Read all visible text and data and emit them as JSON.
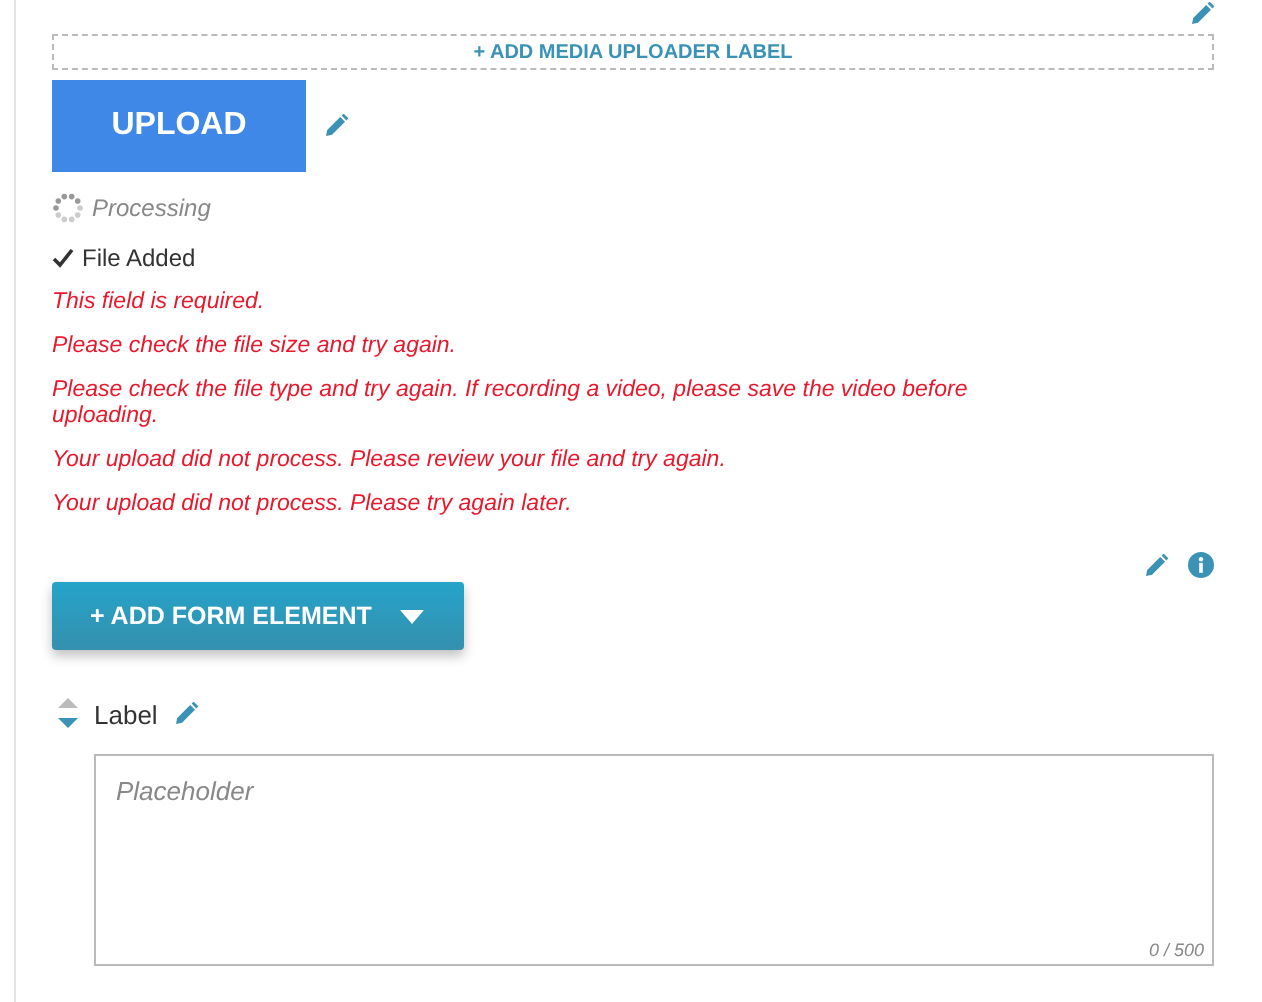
{
  "uploader": {
    "label_button": "+ ADD MEDIA UPLOADER LABEL",
    "upload_button": "UPLOAD",
    "statuses": [
      {
        "kind": "processing",
        "text": "Processing"
      },
      {
        "kind": "done",
        "text": "File Added"
      }
    ],
    "errors": [
      "This field is required.",
      "Please check the file size and try again.",
      "Please check the file type and try again. If recording a video, please save the video before uploading.",
      "Your upload did not process. Please review your file and try again.",
      "Your upload did not process. Please try again later."
    ]
  },
  "add_element_button": {
    "label": "+ ADD FORM ELEMENT"
  },
  "field": {
    "label": "Label",
    "placeholder": "Placeholder",
    "counter": "0 / 500"
  }
}
